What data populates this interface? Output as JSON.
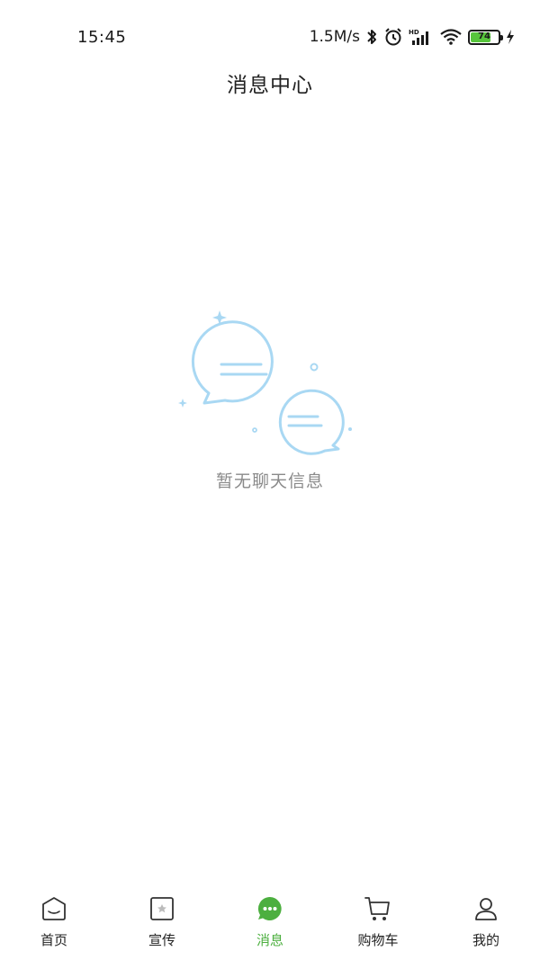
{
  "status_bar": {
    "time": "15:45",
    "network_speed": "1.5M/s",
    "battery_level": "74",
    "battery_percent": 74,
    "icons": [
      "bluetooth-icon",
      "alarm-icon",
      "signal-hd-icon",
      "wifi-icon",
      "battery-icon",
      "charging-icon"
    ]
  },
  "header": {
    "title": "消息中心"
  },
  "empty_state": {
    "message": "暂无聊天信息",
    "illustration_icon": "chat-bubbles-icon",
    "accent_color": "#a9d8f3"
  },
  "tab_bar": {
    "active_color": "#4caf3f",
    "items": [
      {
        "label": "首页",
        "icon": "home-icon",
        "active": false
      },
      {
        "label": "宣传",
        "icon": "star-card-icon",
        "active": false
      },
      {
        "label": "消息",
        "icon": "message-icon",
        "active": true
      },
      {
        "label": "购物车",
        "icon": "cart-icon",
        "active": false
      },
      {
        "label": "我的",
        "icon": "user-icon",
        "active": false
      }
    ]
  }
}
